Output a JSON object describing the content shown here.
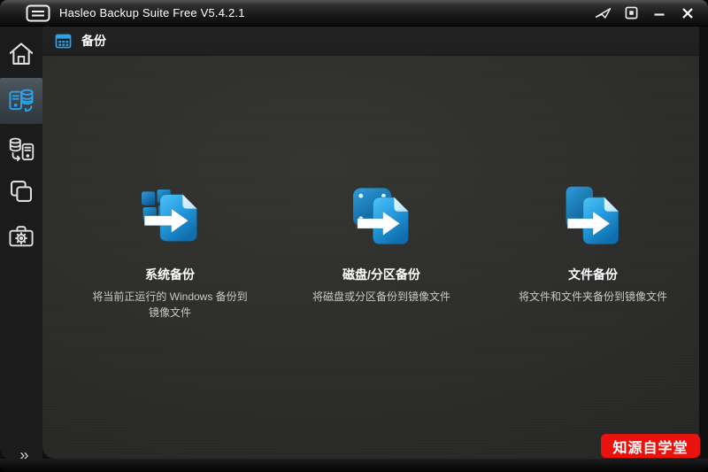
{
  "titlebar": {
    "title": "Hasleo Backup Suite Free V5.4.2.1",
    "app_icon": "app-logo-icon",
    "controls": [
      {
        "name": "feedback-icon"
      },
      {
        "name": "restore-window-icon"
      },
      {
        "name": "minimize-icon"
      },
      {
        "name": "close-icon"
      }
    ]
  },
  "sidebar": {
    "items": [
      {
        "id": "home",
        "icon": "home-icon",
        "selected": false
      },
      {
        "id": "backup",
        "icon": "backup-icon",
        "selected": true
      },
      {
        "id": "restore",
        "icon": "restore-icon",
        "selected": false
      },
      {
        "id": "clone",
        "icon": "clone-icon",
        "selected": false
      },
      {
        "id": "tools",
        "icon": "toolbox-icon",
        "selected": false
      }
    ],
    "expand_glyph": "»"
  },
  "header": {
    "icon": "backup-grid-icon",
    "title": "备份"
  },
  "main": {
    "items": [
      {
        "id": "system-backup",
        "icon": "system-backup-icon",
        "title": "系统备份",
        "description": "将当前正运行的 Windows 备份到\n镜像文件"
      },
      {
        "id": "disk-partition-backup",
        "icon": "disk-backup-icon",
        "title": "磁盘/分区备份",
        "description": "将磁盘或分区备份到镜像文件"
      },
      {
        "id": "file-backup",
        "icon": "file-backup-icon",
        "title": "文件备份",
        "description": "将文件和文件夹备份到镜像文件"
      }
    ]
  },
  "watermark": {
    "text": "知源自学堂",
    "background_color": "#ea120d",
    "text_color": "#ffffff"
  },
  "colors": {
    "accent_blue": "#2aa3e8",
    "panel_bg": "#2c2c2a",
    "sidebar_bg": "#1b1b1b",
    "selected_tile": "#424b53"
  }
}
